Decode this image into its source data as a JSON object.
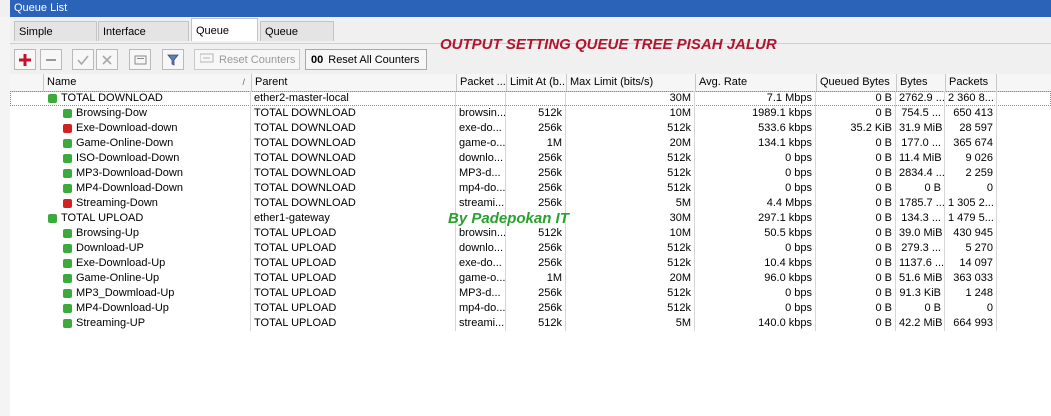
{
  "window": {
    "title": "Queue List"
  },
  "tabs": [
    {
      "label": "Simple Queues",
      "active": false
    },
    {
      "label": "Interface Queues",
      "active": false
    },
    {
      "label": "Queue Tree",
      "active": true
    },
    {
      "label": "Queue Types",
      "active": false
    }
  ],
  "toolbar": {
    "icons": [
      "add-icon",
      "remove-icon",
      "enable-icon",
      "disable-icon",
      "comment-icon",
      "filter-icon"
    ],
    "reset_counters": "Reset Counters",
    "reset_all_counters": "Reset All Counters",
    "reset_all_prefix": "00"
  },
  "overlay": {
    "heading": "OUTPUT SETTING QUEUE TREE PISAH JALUR",
    "credit": "By Padepokan IT"
  },
  "colors": {
    "title_bar": "#2b63b8",
    "heading": "#b2142d",
    "credit": "#2aa12f",
    "queue_green": "#3cab3c",
    "queue_red": "#d32222"
  },
  "table": {
    "columns": [
      "Name",
      "Parent",
      "Packet ...",
      "Limit At (b...",
      "Max Limit (bits/s)",
      "Avg. Rate",
      "Queued Bytes",
      "Bytes",
      "Packets"
    ],
    "rows": [
      {
        "name": "TOTAL DOWNLOAD",
        "level": 0,
        "status": "green",
        "parent": "ether2-master-local",
        "packet": "",
        "limit_at": "",
        "max_limit": "30M",
        "avg_rate": "7.1 Mbps",
        "queued": "0 B",
        "bytes": "2762.9 ...",
        "packets": "2 360 8..."
      },
      {
        "name": "Browsing-Dow",
        "level": 1,
        "status": "green",
        "parent": "TOTAL DOWNLOAD",
        "packet": "browsin...",
        "limit_at": "512k",
        "max_limit": "10M",
        "avg_rate": "1989.1 kbps",
        "queued": "0 B",
        "bytes": "754.5 ...",
        "packets": "650 413"
      },
      {
        "name": "Exe-Download-down",
        "level": 1,
        "status": "red",
        "parent": "TOTAL DOWNLOAD",
        "packet": "exe-do...",
        "limit_at": "256k",
        "max_limit": "512k",
        "avg_rate": "533.6 kbps",
        "queued": "35.2 KiB",
        "bytes": "31.9 MiB",
        "packets": "28 597"
      },
      {
        "name": "Game-Online-Down",
        "level": 1,
        "status": "green",
        "parent": "TOTAL DOWNLOAD",
        "packet": "game-o...",
        "limit_at": "1M",
        "max_limit": "20M",
        "avg_rate": "134.1 kbps",
        "queued": "0 B",
        "bytes": "177.0 ...",
        "packets": "365 674"
      },
      {
        "name": "ISO-Download-Down",
        "level": 1,
        "status": "green",
        "parent": "TOTAL DOWNLOAD",
        "packet": "downlo...",
        "limit_at": "256k",
        "max_limit": "512k",
        "avg_rate": "0 bps",
        "queued": "0 B",
        "bytes": "11.4 MiB",
        "packets": "9 026"
      },
      {
        "name": "MP3-Download-Down",
        "level": 1,
        "status": "green",
        "parent": "TOTAL DOWNLOAD",
        "packet": "MP3-d...",
        "limit_at": "256k",
        "max_limit": "512k",
        "avg_rate": "0 bps",
        "queued": "0 B",
        "bytes": "2834.4 ...",
        "packets": "2 259"
      },
      {
        "name": "MP4-Download-Down",
        "level": 1,
        "status": "green",
        "parent": "TOTAL DOWNLOAD",
        "packet": "mp4-do...",
        "limit_at": "256k",
        "max_limit": "512k",
        "avg_rate": "0 bps",
        "queued": "0 B",
        "bytes": "0 B",
        "packets": "0"
      },
      {
        "name": "Streaming-Down",
        "level": 1,
        "status": "red",
        "parent": "TOTAL DOWNLOAD",
        "packet": "streami...",
        "limit_at": "256k",
        "max_limit": "5M",
        "avg_rate": "4.4 Mbps",
        "queued": "0 B",
        "bytes": "1785.7 ...",
        "packets": "1 305 2..."
      },
      {
        "name": "TOTAL UPLOAD",
        "level": 0,
        "status": "green",
        "parent": "ether1-gateway",
        "packet": "",
        "limit_at": "",
        "max_limit": "30M",
        "avg_rate": "297.1 kbps",
        "queued": "0 B",
        "bytes": "134.3 ...",
        "packets": "1 479 5..."
      },
      {
        "name": "Browsing-Up",
        "level": 1,
        "status": "green",
        "parent": "TOTAL UPLOAD",
        "packet": "browsin...",
        "limit_at": "512k",
        "max_limit": "10M",
        "avg_rate": "50.5 kbps",
        "queued": "0 B",
        "bytes": "39.0 MiB",
        "packets": "430 945"
      },
      {
        "name": "Download-UP",
        "level": 1,
        "status": "green",
        "parent": "TOTAL UPLOAD",
        "packet": "downlo...",
        "limit_at": "256k",
        "max_limit": "512k",
        "avg_rate": "0 bps",
        "queued": "0 B",
        "bytes": "279.3 ...",
        "packets": "5 270"
      },
      {
        "name": "Exe-Download-Up",
        "level": 1,
        "status": "green",
        "parent": "TOTAL UPLOAD",
        "packet": "exe-do...",
        "limit_at": "256k",
        "max_limit": "512k",
        "avg_rate": "10.4 kbps",
        "queued": "0 B",
        "bytes": "1137.6 ...",
        "packets": "14 097"
      },
      {
        "name": "Game-Online-Up",
        "level": 1,
        "status": "green",
        "parent": "TOTAL UPLOAD",
        "packet": "game-o...",
        "limit_at": "1M",
        "max_limit": "20M",
        "avg_rate": "96.0 kbps",
        "queued": "0 B",
        "bytes": "51.6 MiB",
        "packets": "363 033"
      },
      {
        "name": "MP3_Dowmload-Up",
        "level": 1,
        "status": "green",
        "parent": "TOTAL UPLOAD",
        "packet": "MP3-d...",
        "limit_at": "256k",
        "max_limit": "512k",
        "avg_rate": "0 bps",
        "queued": "0 B",
        "bytes": "91.3 KiB",
        "packets": "1 248"
      },
      {
        "name": "MP4-Download-Up",
        "level": 1,
        "status": "green",
        "parent": "TOTAL UPLOAD",
        "packet": "mp4-do...",
        "limit_at": "256k",
        "max_limit": "512k",
        "avg_rate": "0 bps",
        "queued": "0 B",
        "bytes": "0 B",
        "packets": "0"
      },
      {
        "name": "Streaming-UP",
        "level": 1,
        "status": "green",
        "parent": "TOTAL UPLOAD",
        "packet": "streami...",
        "limit_at": "512k",
        "max_limit": "5M",
        "avg_rate": "140.0 kbps",
        "queued": "0 B",
        "bytes": "42.2 MiB",
        "packets": "664 993"
      }
    ]
  }
}
